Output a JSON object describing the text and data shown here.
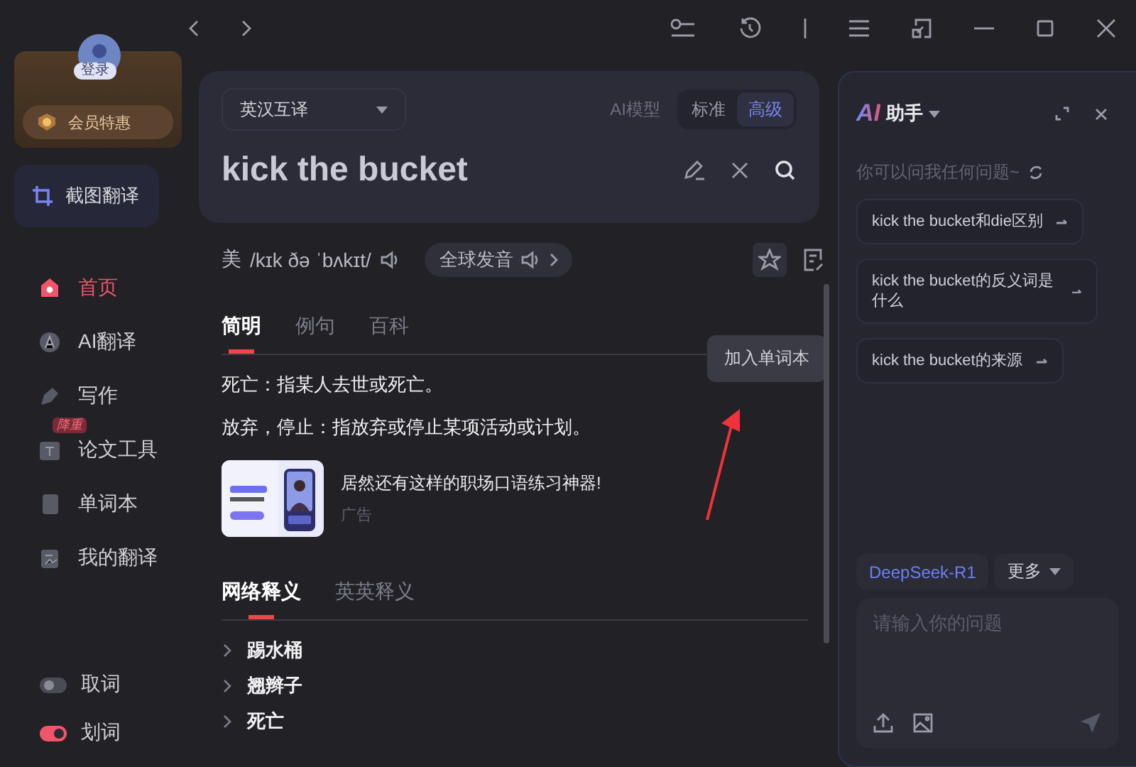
{
  "sidebar": {
    "login_label": "登录",
    "vip_label": "会员特惠",
    "screenshot_button": "截图翻译",
    "nav": [
      {
        "label": "首页",
        "selected": true,
        "kind": "home"
      },
      {
        "label": "AI翻译",
        "selected": false,
        "kind": "ai"
      },
      {
        "label": "写作",
        "selected": false,
        "kind": "write"
      },
      {
        "label": "论文工具",
        "selected": false,
        "kind": "paper",
        "badge": "降重"
      },
      {
        "label": "单词本",
        "selected": false,
        "kind": "words"
      },
      {
        "label": "我的翻译",
        "selected": false,
        "kind": "mine"
      }
    ],
    "toggles": [
      {
        "label": "取词",
        "on": false
      },
      {
        "label": "划词",
        "on": true
      }
    ]
  },
  "search": {
    "language": "英汉互译",
    "model_label": "AI模型",
    "model_options": [
      {
        "label": "标准",
        "selected": false
      },
      {
        "label": "高级",
        "selected": true
      }
    ],
    "query": "kick the bucket"
  },
  "pronunciation": {
    "region": "美",
    "phonetic": "/kɪk ðə ˈbʌkɪt/",
    "global_button": "全球发音"
  },
  "tooltip": "加入单词本",
  "tabs": [
    {
      "label": "简明",
      "selected": true
    },
    {
      "label": "例句",
      "selected": false
    },
    {
      "label": "百科",
      "selected": false
    }
  ],
  "definitions": [
    "死亡：指某人去世或死亡。",
    "放弃，停止：指放弃或停止某项活动或计划。"
  ],
  "ad": {
    "title": "居然还有这样的职场口语练习神器!",
    "label": "广告"
  },
  "web_tabs": [
    {
      "label": "网络释义",
      "selected": true
    },
    {
      "label": "英英释义",
      "selected": false
    }
  ],
  "web_items": [
    {
      "label": "踢水桶",
      "expanded": false
    },
    {
      "label": "翘辫子",
      "expanded": false
    },
    {
      "label": "死亡",
      "expanded": false
    }
  ],
  "assistant": {
    "logo": "AI",
    "title": "助手",
    "hint": "你可以问我任何问题~",
    "suggestions": [
      "kick the bucket和die区别",
      "kick the bucket的反义词是什么",
      "kick the bucket的来源"
    ],
    "model": "DeepSeek-R1",
    "more": "更多",
    "placeholder": "请输入你的问题"
  }
}
